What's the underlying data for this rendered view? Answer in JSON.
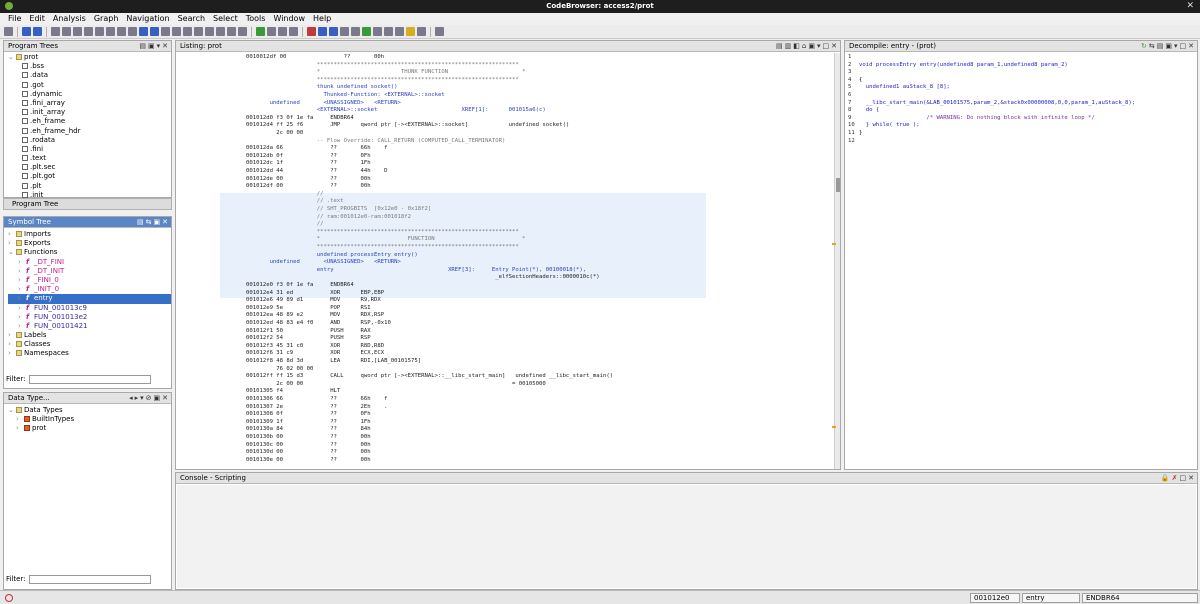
{
  "window": {
    "title": "CodeBrowser: access2/prot"
  },
  "menu": [
    "File",
    "Edit",
    "Analysis",
    "Graph",
    "Navigation",
    "Search",
    "Select",
    "Tools",
    "Window",
    "Help"
  ],
  "program_trees": {
    "title": "Program Trees",
    "root": "prot",
    "items": [
      ".bss",
      ".data",
      ".got",
      ".dynamic",
      ".fini_array",
      ".init_array",
      ".eh_frame",
      ".eh_frame_hdr",
      ".rodata",
      ".fini",
      ".text",
      ".plt.sec",
      ".plt.got",
      ".plt",
      ".init",
      ".rela.plt"
    ],
    "tab": "Program Tree"
  },
  "symbol_tree": {
    "title": "Symbol Tree",
    "groups": [
      "Imports",
      "Exports",
      "Functions"
    ],
    "functions": [
      "_DT_FINI",
      "_DT_INIT",
      "_FINI_0",
      "_INIT_0",
      "entry",
      "FUN_001013c9",
      "FUN_001013e2",
      "FUN_00101421"
    ],
    "selected": "entry",
    "after": [
      "Labels",
      "Classes",
      "Namespaces"
    ],
    "filter_label": "Filter:"
  },
  "data_types": {
    "title": "Data Type...",
    "root": "Data Types",
    "items": [
      "BuiltInTypes",
      "prot"
    ],
    "filter_label": "Filter:"
  },
  "listing": {
    "title": "Listing:  prot",
    "lines": [
      {
        "t": "0010012df 00                 ??       00h"
      },
      {
        "t": "                     ************************************************************"
      },
      {
        "t": "                     *                        THUNK FUNCTION                      *"
      },
      {
        "t": "                     ************************************************************"
      },
      {
        "t": "                     thunk undefined socket()"
      },
      {
        "t": "                       Thunked-Function: <EXTERNAL>::socket"
      },
      {
        "t": "       undefined       <UNASSIGNED>   <RETURN>"
      },
      {
        "t": "                     <EXTERNAL>::socket                         XREF[1]:      001015a6(c)"
      },
      {
        "t": "001012d0 f3 0f 1e fa     ENDBR64"
      },
      {
        "t": "001012d4 ff 25 f6        JMP      qword ptr [-><EXTERNAL>::socket]            undefined socket()"
      },
      {
        "t": "         2c 00 00"
      },
      {
        "t": "                     -- Flow Override: CALL_RETURN (COMPUTED_CALL_TERMINATOR)"
      },
      {
        "t": "001012da 66              ??       66h    f"
      },
      {
        "t": "001012db 0f              ??       0Fh"
      },
      {
        "t": "001012dc 1f              ??       1Fh"
      },
      {
        "t": "001012dd 44              ??       44h    D"
      },
      {
        "t": "001012de 00              ??       00h"
      },
      {
        "t": "001012df 00              ??       00h"
      },
      {
        "t": "                     //"
      },
      {
        "t": "                     // .text"
      },
      {
        "t": "                     // SHT_PROGBITS  [0x12e0 - 0x18f2]"
      },
      {
        "t": "                     // ram:001012e0-ram:001018f2"
      },
      {
        "t": "                     //"
      },
      {
        "t": "                     ************************************************************"
      },
      {
        "t": "                     *                          FUNCTION                          *"
      },
      {
        "t": "                     ************************************************************"
      },
      {
        "t": "                     undefined processEntry entry()"
      },
      {
        "t": "       undefined       <UNASSIGNED>   <RETURN>"
      },
      {
        "t": "                     entry                                  XREF[3]:     Entry Point(*), 00100018(*),"
      },
      {
        "t": "                                                                          _elfSectionHeaders::0000010c(*)"
      },
      {
        "t": "001012e0 f3 0f 1e fa     ENDBR64"
      },
      {
        "t": "001012e4 31 ed           XOR      EBP,EBP"
      },
      {
        "t": "001012e6 49 89 d1        MOV      R9,RDX"
      },
      {
        "t": "001012e9 5e              POP      RSI"
      },
      {
        "t": "001012ea 48 89 e2        MOV      RDX,RSP"
      },
      {
        "t": "001012ed 48 83 e4 f0     AND      RSP,-0x10"
      },
      {
        "t": "001012f1 50              PUSH     RAX"
      },
      {
        "t": "001012f2 54              PUSH     RSP"
      },
      {
        "t": "001012f3 45 31 c0        XOR      R8D,R8D"
      },
      {
        "t": "001012f6 31 c9           XOR      ECX,ECX"
      },
      {
        "t": "001012f8 48 8d 3d        LEA      RDI,[LAB_00101575]"
      },
      {
        "t": "         76 02 00 00"
      },
      {
        "t": "001012ff ff 15 d3        CALL     qword ptr [-><EXTERNAL>::__libc_start_main]   undefined __libc_start_main()"
      },
      {
        "t": "         2c 00 00                                                              = 00105000"
      },
      {
        "t": "00101305 f4              HLT"
      },
      {
        "t": "00101306 66              ??       66h    f"
      },
      {
        "t": "00101307 2e              ??       2Eh    ."
      },
      {
        "t": "00101308 0f              ??       0Fh"
      },
      {
        "t": "00101309 1f              ??       1Fh"
      },
      {
        "t": "0010130a 84              ??       84h"
      },
      {
        "t": "0010130b 00              ??       00h"
      },
      {
        "t": "0010130c 00              ??       00h"
      },
      {
        "t": "0010130d 00              ??       00h"
      },
      {
        "t": "0010130e 00              ??       00h"
      }
    ]
  },
  "decompile": {
    "title": "Decompile: entry - (prot)",
    "lines": [
      "",
      "void processEntry entry(undefined8 param_1,undefined8 param_2)",
      "",
      "{",
      "  undefined1 auStack_8 [8];",
      "",
      "  __libc_start_main(&LAB_00101575,param_2,&stack0x00000008,0,0,param_1,auStack_8);",
      "  do {",
      "                    /* WARNING: Do nothing block with infinite loop */",
      "  } while( true );",
      "}",
      ""
    ]
  },
  "console": {
    "title": "Console - Scripting"
  },
  "status": {
    "address": "001012e0",
    "function": "entry",
    "instruction": "ENDBR64"
  }
}
